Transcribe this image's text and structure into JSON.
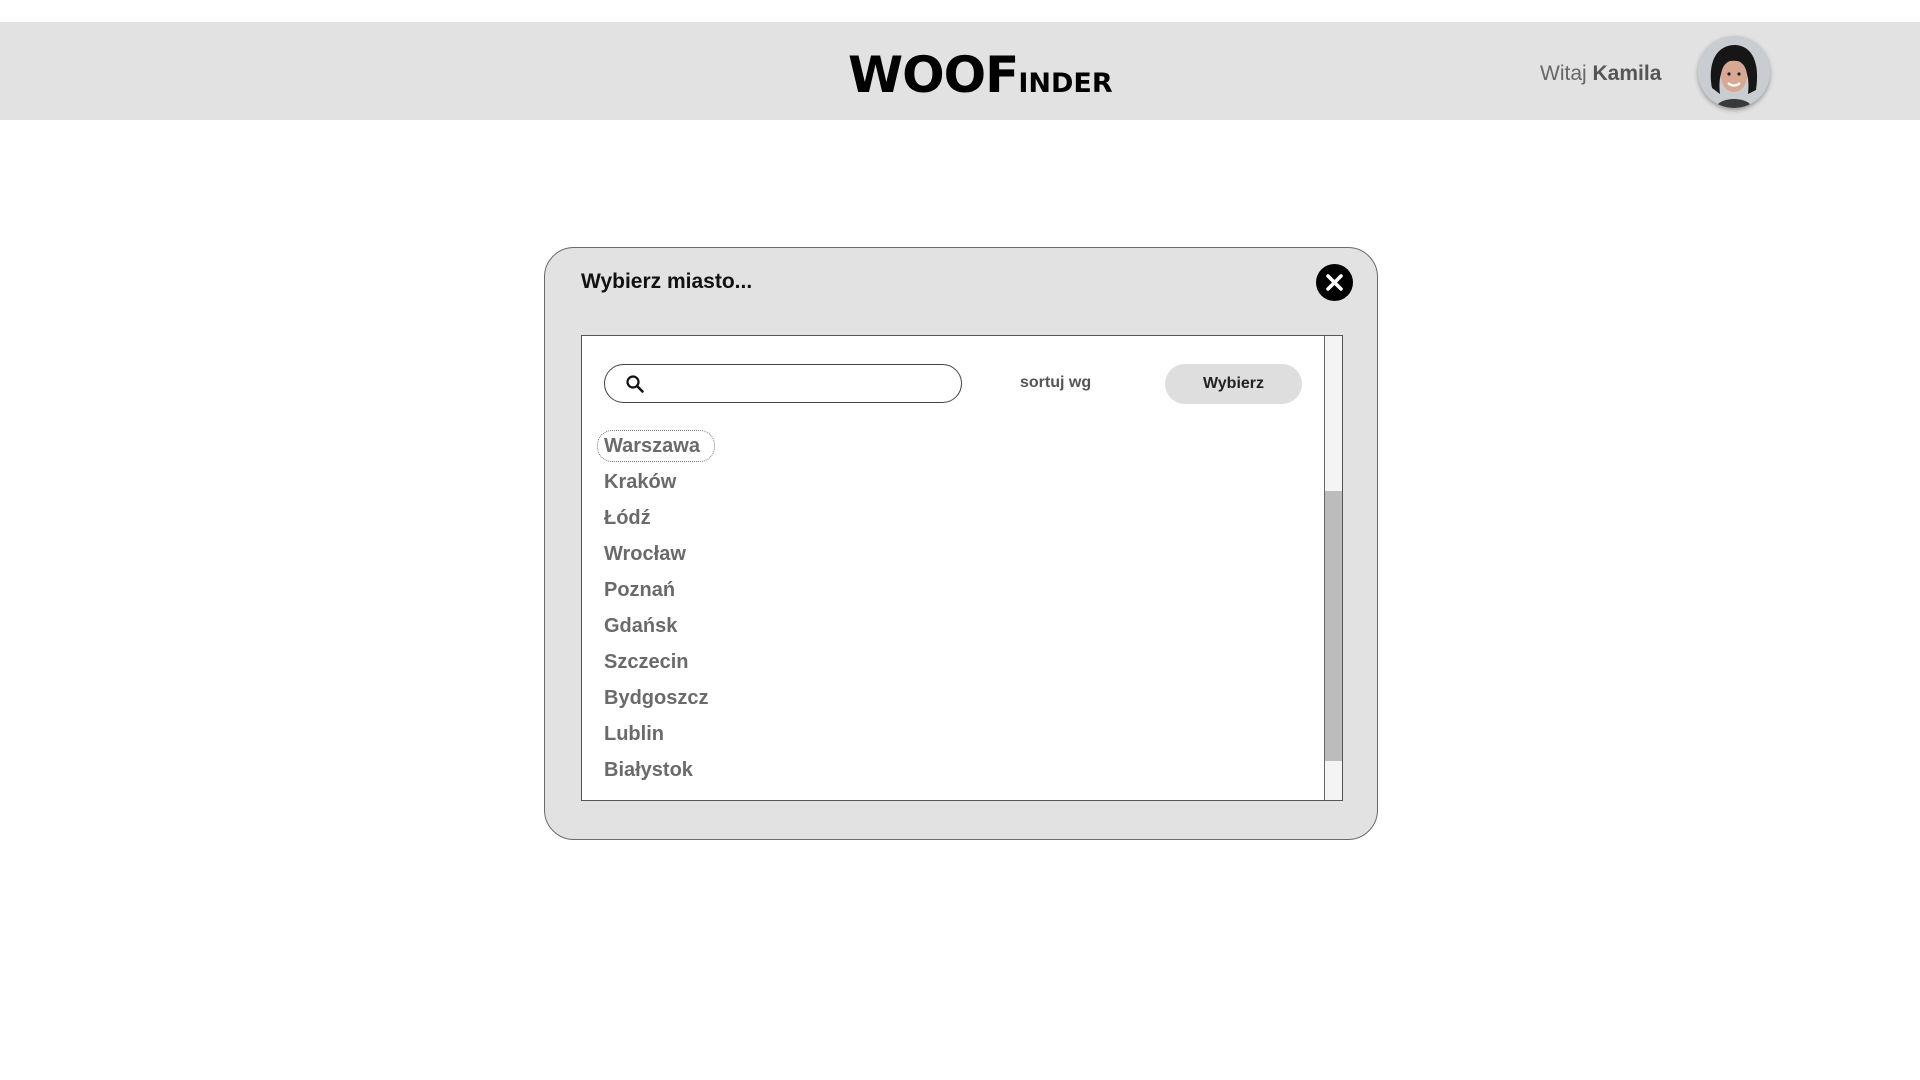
{
  "header": {
    "logo_big": "WOOF",
    "logo_small": "INDER",
    "greeting_prefix": "Witaj",
    "user_name": "Kamila"
  },
  "modal": {
    "title": "Wybierz miasto...",
    "search_placeholder": "",
    "search_value": "",
    "sort_label": "sortuj wg",
    "select_button": "Wybierz",
    "cities": [
      "Warszawa",
      "Kraków",
      "Łódź",
      "Wrocław",
      "Poznań",
      "Gdańsk",
      "Szczecin",
      "Bydgoszcz",
      "Lublin",
      "Białystok"
    ],
    "focused_city": "Warszawa"
  },
  "colors": {
    "header_bg": "#e2e2e2",
    "modal_bg": "#e2e2e2",
    "city_text": "#6a6a6a",
    "button_bg": "#dedede"
  },
  "icons": {
    "close": "close-icon",
    "search": "search-icon",
    "avatar": "user-avatar"
  }
}
